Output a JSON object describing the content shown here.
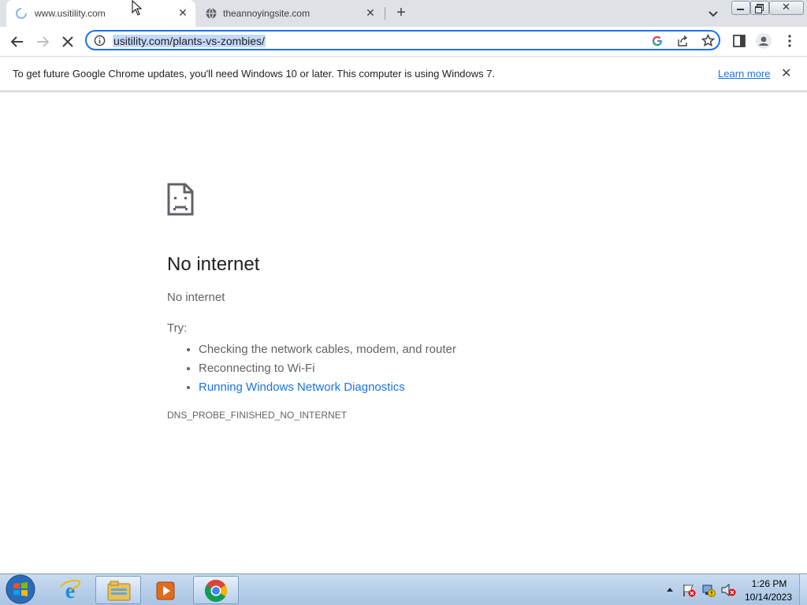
{
  "browser": {
    "tabs": [
      {
        "title": "www.usitility.com",
        "active": true,
        "loading": true
      },
      {
        "title": "theannoyingsite.com",
        "active": false,
        "icon": "globe-icon"
      }
    ],
    "address_bar": {
      "url": "usitility.com/plants-vs-zombies/"
    }
  },
  "infobar": {
    "message": "To get future Google Chrome updates, you'll need Windows 10 or later. This computer is using Windows 7.",
    "link": "Learn more"
  },
  "error_page": {
    "heading": "No internet",
    "subtext": "No internet",
    "try_label": "Try:",
    "suggestions": [
      "Checking the network cables, modem, and router",
      "Reconnecting to Wi-Fi",
      "Running Windows Network Diagnostics"
    ],
    "error_code": "DNS_PROBE_FINISHED_NO_INTERNET"
  },
  "taskbar": {
    "apps": [
      "internet-explorer-icon",
      "file-explorer-icon",
      "media-player-icon",
      "chrome-icon"
    ],
    "tray_icons": [
      "show-hidden-icons-icon",
      "action-center-flag-icon",
      "network-icon",
      "volume-muted-icon"
    ],
    "clock": {
      "time": "1:26 PM",
      "date": "10/14/2023"
    }
  },
  "colors": {
    "accent": "#1a73e8",
    "tabstrip": "#dee1e6",
    "taskbar": "#b9d1ea"
  }
}
